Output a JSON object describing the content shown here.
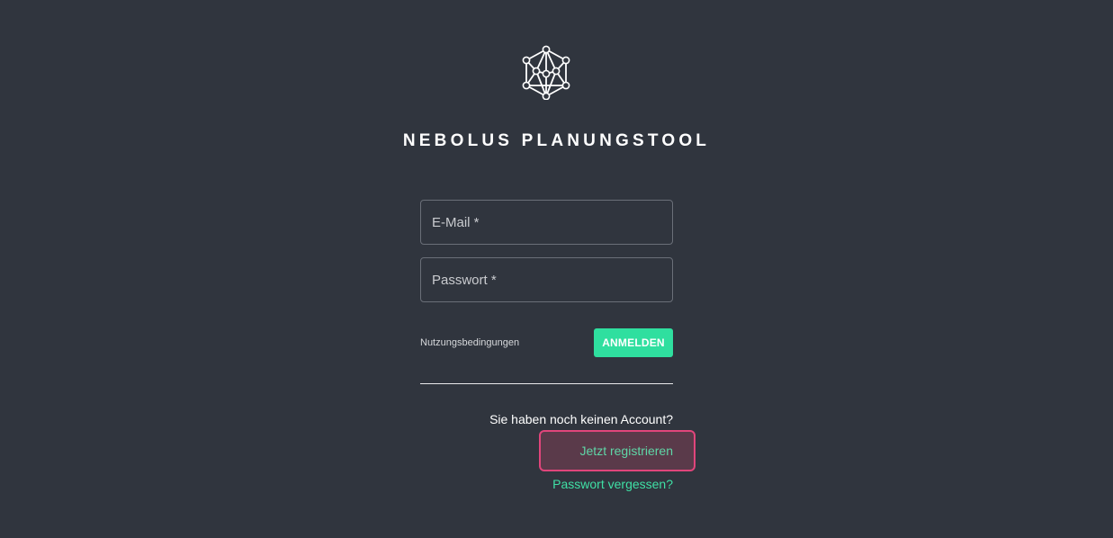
{
  "app": {
    "title": "NEBOLUS PLANUNGSTOOL",
    "logo_icon": "network-polyhedron-icon"
  },
  "login_form": {
    "email_placeholder": "E-Mail *",
    "email_value": "",
    "password_placeholder": "Passwort *",
    "password_value": "",
    "terms_label": "Nutzungsbedingungen",
    "login_label": "ANMELDEN"
  },
  "registration": {
    "prompt": "Sie haben noch keinen Account?",
    "register_label": "Jetzt registrieren",
    "forgot_password_label": "Passwort vergessen?"
  },
  "colors": {
    "background": "#30353e",
    "accent": "#2fdf9f",
    "highlight_border": "#e0457b"
  }
}
